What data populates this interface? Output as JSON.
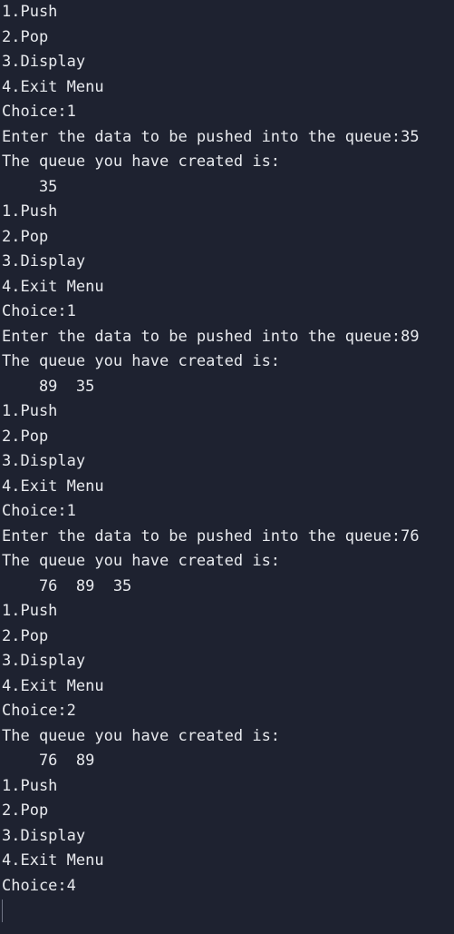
{
  "terminal": {
    "lines": [
      "1.Push",
      "2.Pop",
      "3.Display",
      "4.Exit Menu",
      "Choice:1",
      "Enter the data to be pushed into the queue:35",
      "The queue you have created is:",
      "    35",
      "1.Push",
      "2.Pop",
      "3.Display",
      "4.Exit Menu",
      "Choice:1",
      "Enter the data to be pushed into the queue:89",
      "The queue you have created is:",
      "    89  35",
      "1.Push",
      "2.Pop",
      "3.Display",
      "4.Exit Menu",
      "Choice:1",
      "Enter the data to be pushed into the queue:76",
      "The queue you have created is:",
      "    76  89  35",
      "1.Push",
      "2.Pop",
      "3.Display",
      "4.Exit Menu",
      "Choice:2",
      "The queue you have created is:",
      "    76  89",
      "1.Push",
      "2.Pop",
      "3.Display",
      "4.Exit Menu",
      "Choice:4"
    ]
  }
}
